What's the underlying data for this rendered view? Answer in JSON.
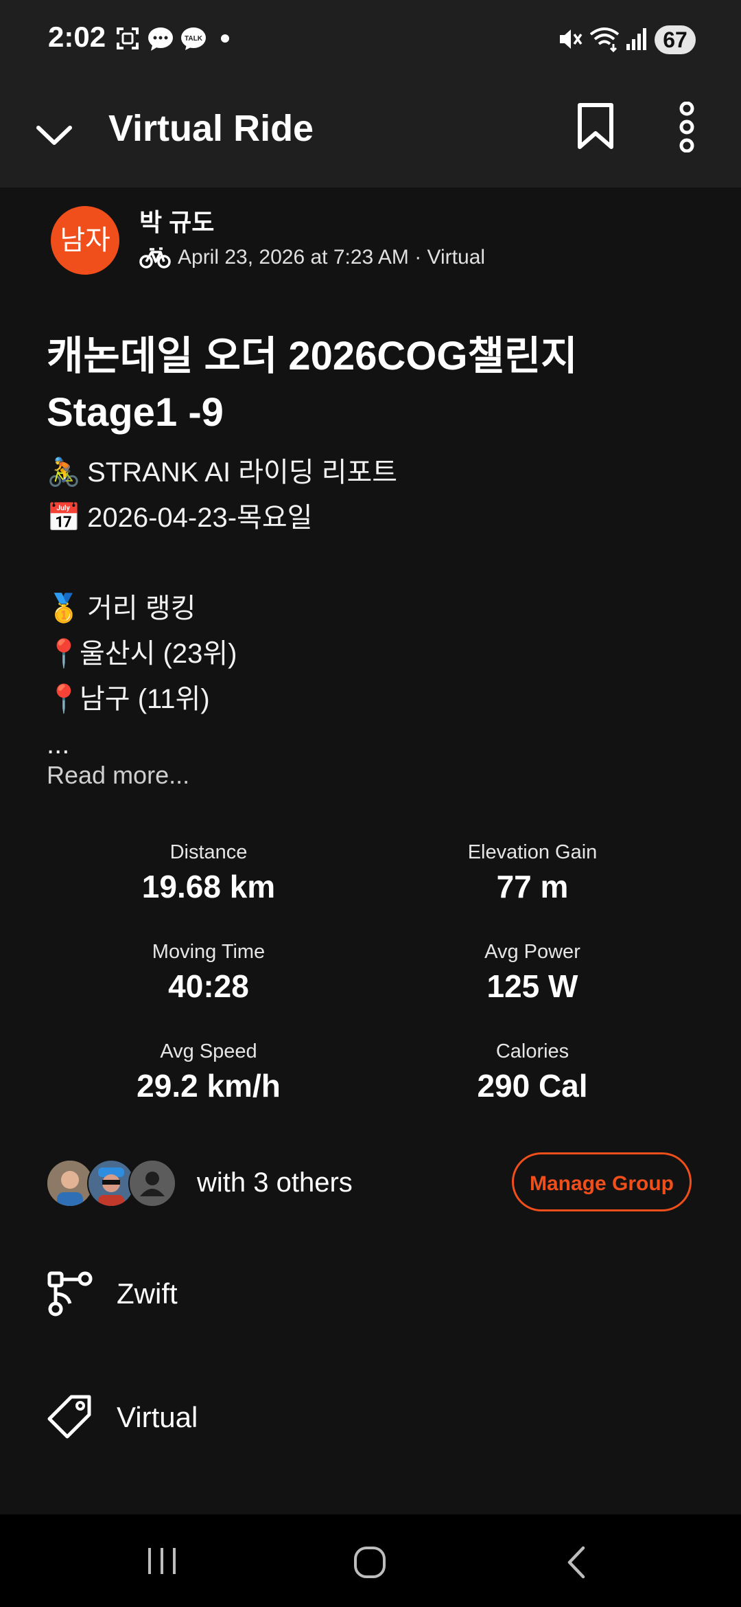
{
  "status_bar": {
    "time": "2:02",
    "battery": "67",
    "icons": [
      "screenshot-icon",
      "chat-icon",
      "talk-icon",
      "dot-icon",
      "mute-icon",
      "wifi-icon",
      "signal-icon",
      "battery-icon"
    ]
  },
  "app_bar": {
    "title": "Virtual Ride",
    "icons": [
      "chevron-down-icon",
      "bookmark-icon",
      "more-vertical-icon"
    ]
  },
  "athlete": {
    "avatar_text": "남자",
    "name": "박 규도",
    "meta": "April 23, 2026 at 7:23 AM · Virtual"
  },
  "activity": {
    "title": "캐논데일 오더 2026COG챌린지 Stage1 -9",
    "description": [
      {
        "emoji": "🚴",
        "text": " STRANK AI 라이딩 리포트"
      },
      {
        "emoji": "📅",
        "text": " 2026-04-23-목요일"
      },
      {
        "emoji": "",
        "text": ""
      },
      {
        "emoji": "🥇",
        "text": " 거리 랭킹"
      },
      {
        "emoji": "📍",
        "text": "울산시 (23위)"
      },
      {
        "emoji": "📍",
        "text": "남구 (11위)"
      },
      {
        "emoji": "",
        "text": "..."
      }
    ],
    "read_more": "Read more..."
  },
  "stats": [
    {
      "label": "Distance",
      "value": "19.68 km"
    },
    {
      "label": "Elevation Gain",
      "value": "77 m"
    },
    {
      "label": "Moving Time",
      "value": "40:28"
    },
    {
      "label": "Avg Power",
      "value": "125 W"
    },
    {
      "label": "Avg Speed",
      "value": "29.2 km/h"
    },
    {
      "label": "Calories",
      "value": "290 Cal"
    }
  ],
  "group": {
    "text": "with 3 others",
    "button": "Manage Group"
  },
  "details": {
    "device": "Zwift",
    "tag": "Virtual"
  },
  "colors": {
    "accent": "#f04e1a",
    "background": "#121212",
    "bar": "#1f1f1f"
  }
}
